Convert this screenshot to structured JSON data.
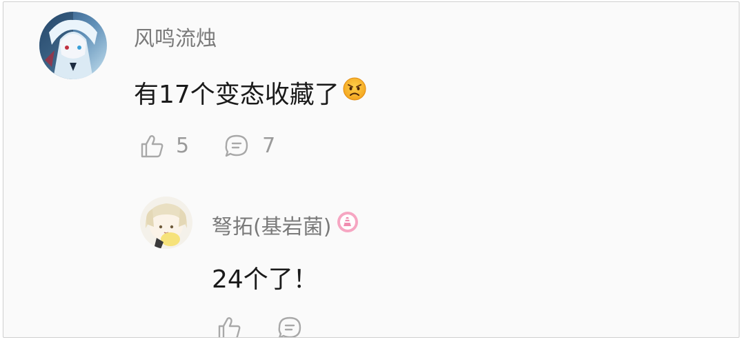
{
  "comments": [
    {
      "username": "风鸣流烛",
      "content": "有17个变态收藏了",
      "emoji": "angry-face",
      "likes": "5",
      "replies": "7"
    }
  ],
  "reply": {
    "username": "弩拓(基岩菌)",
    "badge": "pink-level-badge",
    "content": "24个了！",
    "likes": "",
    "replies": ""
  },
  "colors": {
    "username": "#7a7a7a",
    "content": "#1a1a1a",
    "icon": "#a8a8a8",
    "badge": "#f08cb0"
  }
}
